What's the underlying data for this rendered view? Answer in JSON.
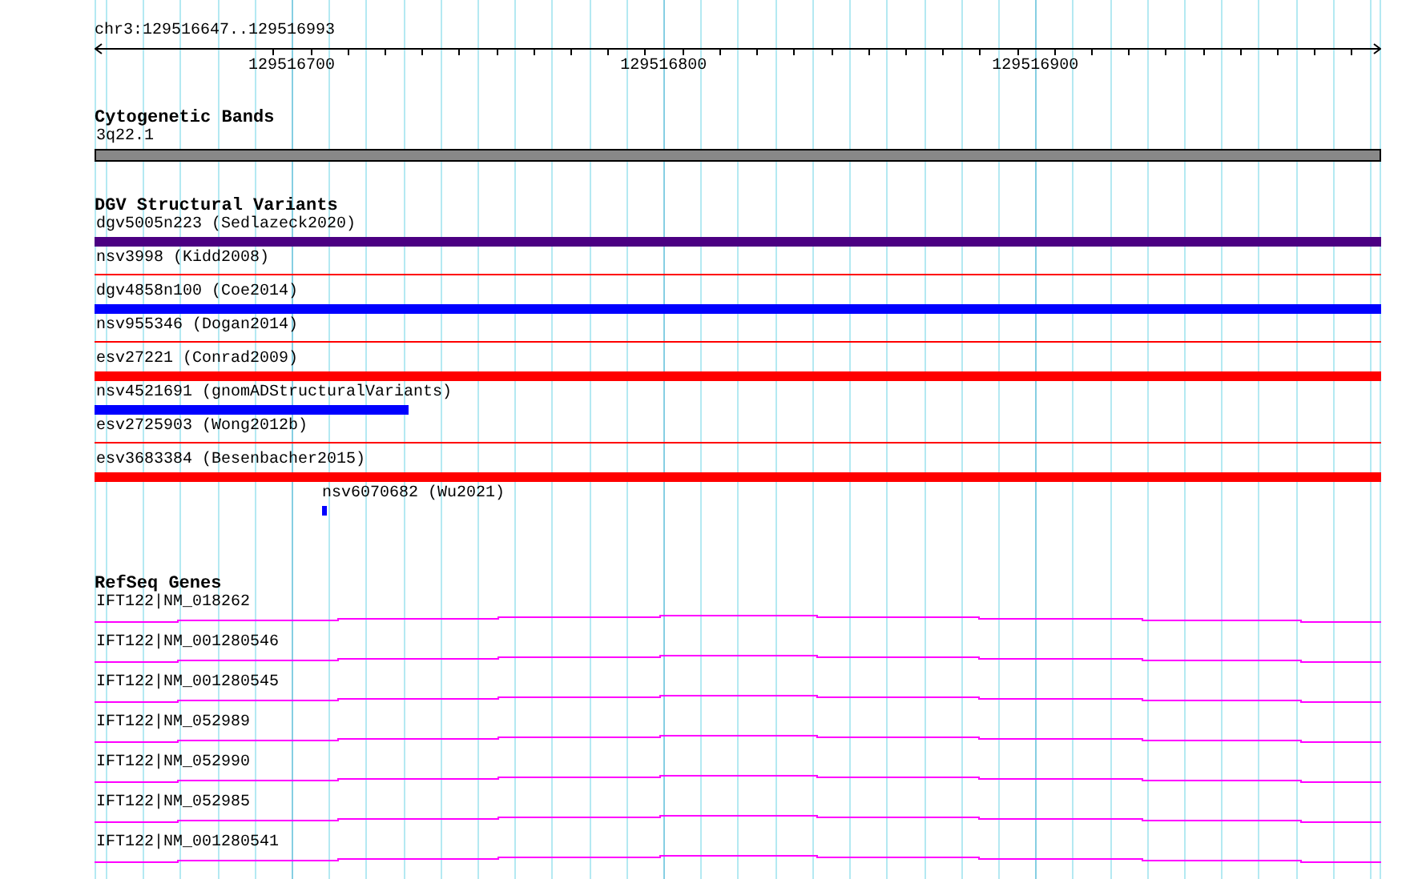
{
  "location": "chr3:129516647..129516993",
  "ruler": {
    "ticks": [
      "129516700",
      "129516800",
      "129516900"
    ]
  },
  "tracks": [
    {
      "kind": "bands",
      "title": "Cytogenetic Bands",
      "features": [
        {
          "label": "3q22.1",
          "kind": "band"
        }
      ]
    },
    {
      "kind": "variants",
      "title": "DGV Structural Variants",
      "features": [
        {
          "label": "dgv5005n223 (Sedlazeck2020)",
          "kind": "bar",
          "color": "#4b0082",
          "level": 1
        },
        {
          "label": "nsv3998 (Kidd2008)",
          "kind": "line",
          "color": "#ff0000",
          "level": 1
        },
        {
          "label": "dgv4858n100 (Coe2014)",
          "kind": "bar",
          "color": "#0000ff",
          "level": 1
        },
        {
          "label": "nsv955346 (Dogan2014)",
          "kind": "line",
          "color": "#ff0000",
          "level": 1
        },
        {
          "label": "esv27221 (Conrad2009)",
          "kind": "bar",
          "color": "#ff0000",
          "level": 1
        },
        {
          "label": "nsv4521691 (gnomADStructuralVariants)",
          "kind": "bar",
          "color": "#0000ff",
          "level": 0.244
        },
        {
          "label": "esv2725903 (Wong2012b)",
          "kind": "line",
          "color": "#ff0000",
          "level": 1
        },
        {
          "label": "esv3683384 (Besenbacher2015)",
          "kind": "bar",
          "color": "#ff0000",
          "level": 1
        },
        {
          "label": "nsv6070682 (Wu2021)",
          "kind": "marker",
          "color": "#0000ff"
        }
      ]
    },
    {
      "kind": "genes",
      "title": "RefSeq Genes",
      "features": [
        {
          "label": "IFT122|NM_018262",
          "kind": "gene"
        },
        {
          "label": "IFT122|NM_001280546",
          "kind": "gene"
        },
        {
          "label": "IFT122|NM_001280545",
          "kind": "gene"
        },
        {
          "label": "IFT122|NM_052989",
          "kind": "gene"
        },
        {
          "label": "IFT122|NM_052990",
          "kind": "gene"
        },
        {
          "label": "IFT122|NM_052985",
          "kind": "gene"
        },
        {
          "label": "IFT122|NM_001280541",
          "kind": "gene"
        }
      ]
    }
  ]
}
